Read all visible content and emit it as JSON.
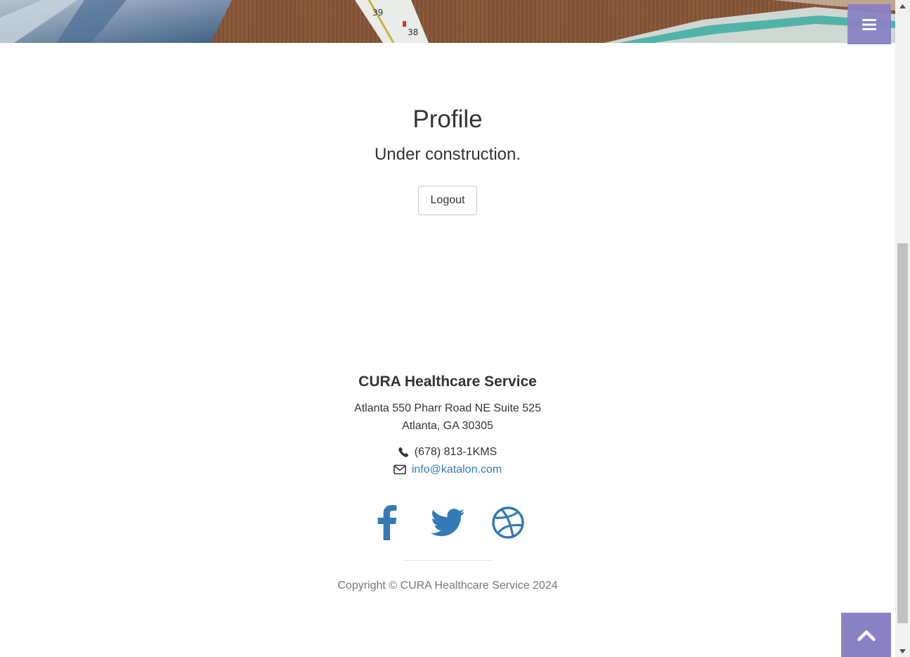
{
  "header": {
    "banner_image": "teddy-bear-thermometer-photo",
    "menu_icon": "hamburger-icon"
  },
  "main": {
    "title": "Profile",
    "subtitle": "Under construction.",
    "logout_label": "Logout"
  },
  "footer": {
    "company": "CURA Healthcare Service",
    "address_line1": "Atlanta 550 Pharr Road NE Suite 525",
    "address_line2": "Atlanta, GA 30305",
    "phone": "(678) 813-1KMS",
    "email": "info@katalon.com",
    "social": [
      "facebook-icon",
      "twitter-icon",
      "dribbble-icon"
    ],
    "copyright": "Copyright © CURA Healthcare Service 2024"
  },
  "colors": {
    "accent": "#8a82c4",
    "link": "#337ab7",
    "text": "#333333",
    "muted": "#777777"
  },
  "to_top_icon": "chevron-up-icon"
}
